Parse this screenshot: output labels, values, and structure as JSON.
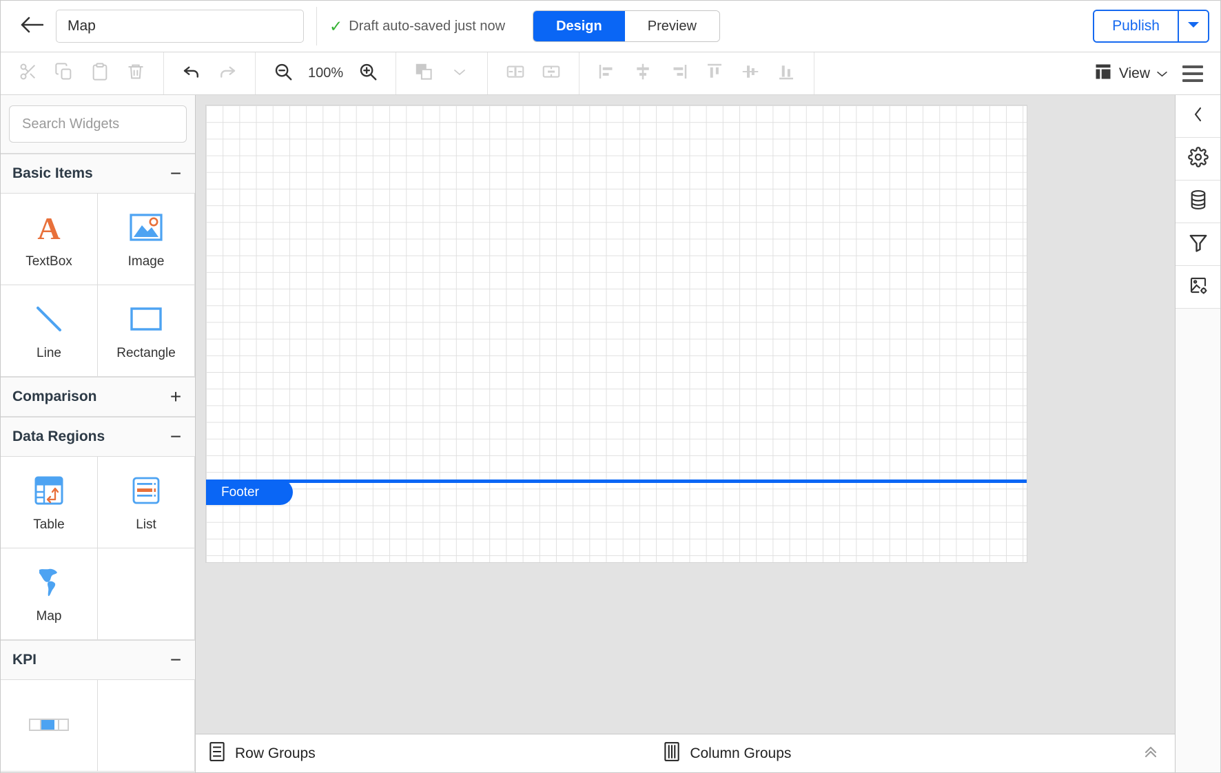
{
  "topbar": {
    "back_icon": "arrow-left-icon",
    "report_title_value": "Map",
    "report_title_placeholder": "Report name",
    "autosave_text": "Draft auto-saved just now",
    "check_glyph": "✓",
    "mode_tabs": [
      {
        "label": "Design",
        "active": true
      },
      {
        "label": "Preview",
        "active": false
      }
    ],
    "publish_label": "Publish",
    "publish_caret_icon": "chevron-down-icon",
    "accent_blue": "#0a66f5",
    "publish_blue": "#1569f0"
  },
  "toolbar": {
    "clipboard": [
      {
        "name": "cut",
        "icon": "scissors-icon",
        "enabled": false
      },
      {
        "name": "copy",
        "icon": "copy-icon",
        "enabled": false
      },
      {
        "name": "paste",
        "icon": "paste-icon",
        "enabled": false
      },
      {
        "name": "delete",
        "icon": "trash-icon",
        "enabled": false
      }
    ],
    "history": [
      {
        "name": "undo",
        "icon": "undo-icon",
        "enabled": true
      },
      {
        "name": "redo",
        "icon": "redo-icon",
        "enabled": false
      }
    ],
    "zoom": {
      "out_icon": "zoom-out-icon",
      "in_icon": "zoom-in-icon",
      "level": "100%"
    },
    "arrange": [
      {
        "name": "bring-to-front",
        "icon": "layers-icon",
        "enabled": false
      },
      {
        "name": "arrange-menu",
        "icon": "chevron-down-icon",
        "enabled": false
      }
    ],
    "distribute": [
      {
        "name": "distribute-horizontally",
        "icon": "distribute-horizontal-icon",
        "enabled": false
      },
      {
        "name": "distribute-vertically",
        "icon": "distribute-vertical-icon",
        "enabled": false
      }
    ],
    "align": [
      {
        "name": "align-left",
        "icon": "align-left-icon",
        "enabled": false
      },
      {
        "name": "align-center",
        "icon": "align-center-icon",
        "enabled": false
      },
      {
        "name": "align-right",
        "icon": "align-right-icon",
        "enabled": false
      },
      {
        "name": "align-top",
        "icon": "align-top-icon",
        "enabled": false
      },
      {
        "name": "align-middle",
        "icon": "align-middle-icon",
        "enabled": false
      },
      {
        "name": "align-bottom",
        "icon": "align-bottom-icon",
        "enabled": false
      }
    ],
    "view_label": "View",
    "view_icon": "layout-icon",
    "view_caret_icon": "chevron-down-icon",
    "menu_icon": "hamburger-icon"
  },
  "widgets_panel": {
    "search_placeholder": "Search Widgets",
    "search_value": "",
    "search_icon": "search-icon",
    "sections": [
      {
        "title": "Basic Items",
        "expanded": true,
        "toggle": "−",
        "items": [
          {
            "label": "TextBox",
            "icon": "textbox-icon"
          },
          {
            "label": "Image",
            "icon": "image-icon"
          },
          {
            "label": "Line",
            "icon": "line-icon"
          },
          {
            "label": "Rectangle",
            "icon": "rectangle-icon"
          }
        ]
      },
      {
        "title": "Comparison",
        "expanded": false,
        "toggle": "+",
        "items": []
      },
      {
        "title": "Data Regions",
        "expanded": true,
        "toggle": "−",
        "items": [
          {
            "label": "Table",
            "icon": "table-icon"
          },
          {
            "label": "List",
            "icon": "list-icon"
          },
          {
            "label": "Map",
            "icon": "map-icon"
          }
        ]
      },
      {
        "title": "KPI",
        "expanded": true,
        "toggle": "−",
        "items": []
      }
    ]
  },
  "canvas": {
    "footer_band_label": "Footer",
    "grid_on": true
  },
  "groups_bar": {
    "row_groups_label": "Row Groups",
    "row_groups_icon": "rows-icon",
    "column_groups_label": "Column Groups",
    "column_groups_icon": "columns-icon",
    "collapse_icon": "chevrons-up-icon"
  },
  "right_rail": {
    "buttons": [
      {
        "name": "collapse-panel",
        "icon": "chevron-left-icon"
      },
      {
        "name": "properties",
        "icon": "gear-icon"
      },
      {
        "name": "data-sources",
        "icon": "database-icon"
      },
      {
        "name": "filters",
        "icon": "filter-icon"
      },
      {
        "name": "image-settings",
        "icon": "image-settings-icon"
      }
    ]
  }
}
